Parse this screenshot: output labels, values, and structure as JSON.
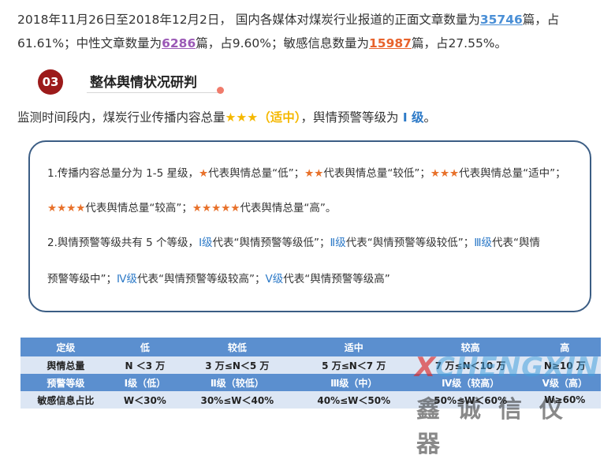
{
  "intro": {
    "part1": "2018年11月26日至2018年12月2日， 国内各媒体对煤炭行业报道的正面文章数量为",
    "positive_count": "35746",
    "part2": "篇，占61.61%；中性文章数量为",
    "neutral_count": "6286",
    "part3": "篇，占9.60%；敏感信息数量为",
    "sensitive_count": "15987",
    "part4": "篇，占27.55%。"
  },
  "section": {
    "number": "03",
    "title": "整体舆情状况研判"
  },
  "summary": {
    "prefix": "监测时间段内，煤炭行业传播内容总量",
    "stars": "★★★",
    "label": "（适中）",
    "middle": "，舆情预警等级为",
    "level": " Ⅰ 级",
    "suffix": "。"
  },
  "panel": {
    "l1_a": "1.传播内容总量分为 1-5 星级，",
    "l1_s1": "★",
    "l1_b": "代表舆情总量“低”；",
    "l1_s2": "★★",
    "l1_c": "代表舆情总量“较低”；",
    "l1_s3": "★★★",
    "l1_d": "代表舆情总量“适中”；",
    "l2_s4": "★★★★",
    "l2_a": "代表舆情总量“较高”；",
    "l2_s5": "★★★★★",
    "l2_b": "代表舆情总量“高”。",
    "l3_a": "2.舆情预警等级共有 5 个等级，",
    "l3_g1": "Ⅰ级",
    "l3_b": "代表“舆情预警等级低”；",
    "l3_g2": "Ⅱ级",
    "l3_c": "代表“舆情预警等级较低”；",
    "l3_g3": "Ⅲ级",
    "l3_d": "代表“舆情",
    "l4_a": "预警等级中”；",
    "l4_g4": "Ⅳ级",
    "l4_b": "代表“舆情预警等级较高”；",
    "l4_g5": "Ⅴ级",
    "l4_c": "代表“舆情预警等级高”"
  },
  "table": {
    "header": [
      "定级",
      "低",
      "较低",
      "适中",
      "较高",
      "高"
    ],
    "rows": [
      [
        "舆情总量",
        "N ＜3 万",
        "3 万≤N＜5 万",
        "5 万≤N＜7 万",
        "7 万≤N＜10 万",
        "N≥10 万"
      ],
      [
        "预警等级",
        "Ⅰ级（低）",
        "Ⅱ级（较低）",
        "Ⅲ级（中）",
        "Ⅳ级（较高）",
        "Ⅴ级（高）"
      ],
      [
        "敏感信息占比",
        "W＜30%",
        "30%≤W＜40%",
        "40%≤W＜50%",
        "50%≤W＜60%",
        "W≥60%"
      ]
    ]
  },
  "watermark": {
    "logo_x": "X",
    "logo_rest": "CHENGXIN",
    "cn": "鑫诚信仪器"
  }
}
